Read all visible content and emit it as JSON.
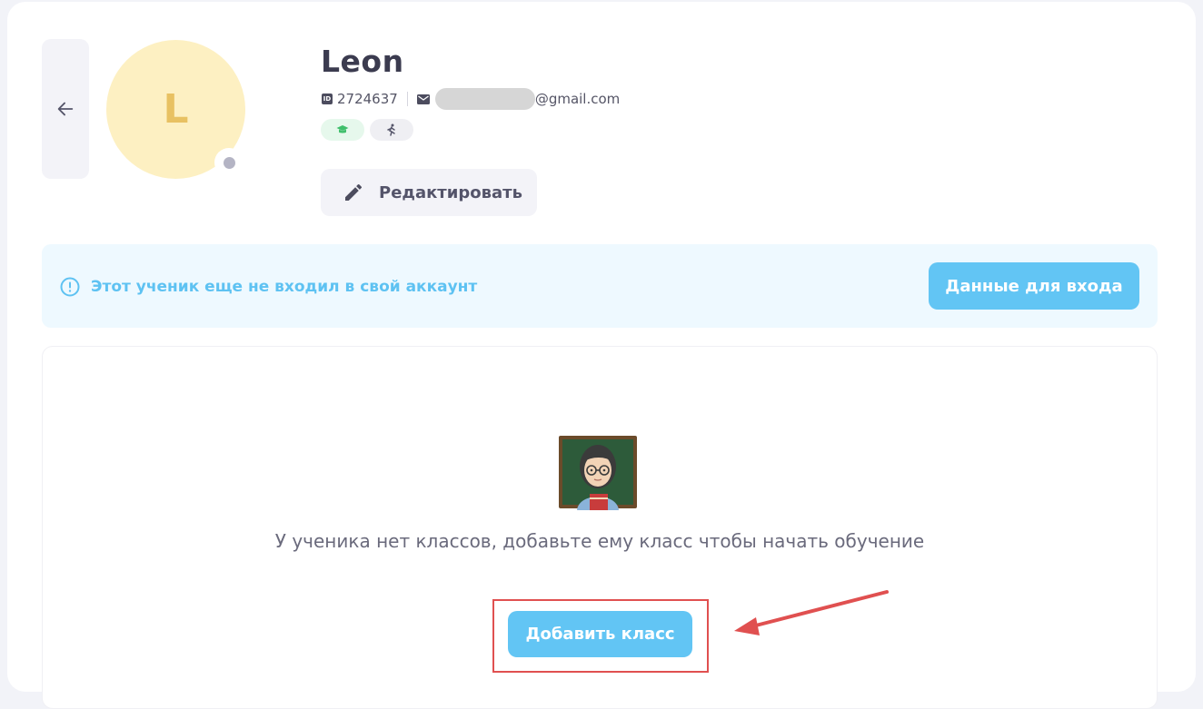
{
  "profile": {
    "avatar_letter": "L",
    "name": "Leon",
    "id_badge": "ID",
    "id": "2724637",
    "email_suffix": "@gmail.com",
    "tags": [
      {
        "icon": "graduation-cap-icon",
        "color": "#3fbf6b"
      },
      {
        "icon": "running-person-icon",
        "color": "#55556a"
      }
    ],
    "edit_label": "Редактировать"
  },
  "notice": {
    "text": "Этот ученик еще не входил в свой аккаунт",
    "button_label": "Данные для входа"
  },
  "classes": {
    "empty_text": "У ученика нет классов, добавьте ему класс чтобы начать обучение",
    "add_button_label": "Добавить класс"
  },
  "colors": {
    "accent": "#62c5f4",
    "annotation": "#e05050",
    "avatar_bg": "#fdf0c2",
    "avatar_text": "#e8c162"
  }
}
